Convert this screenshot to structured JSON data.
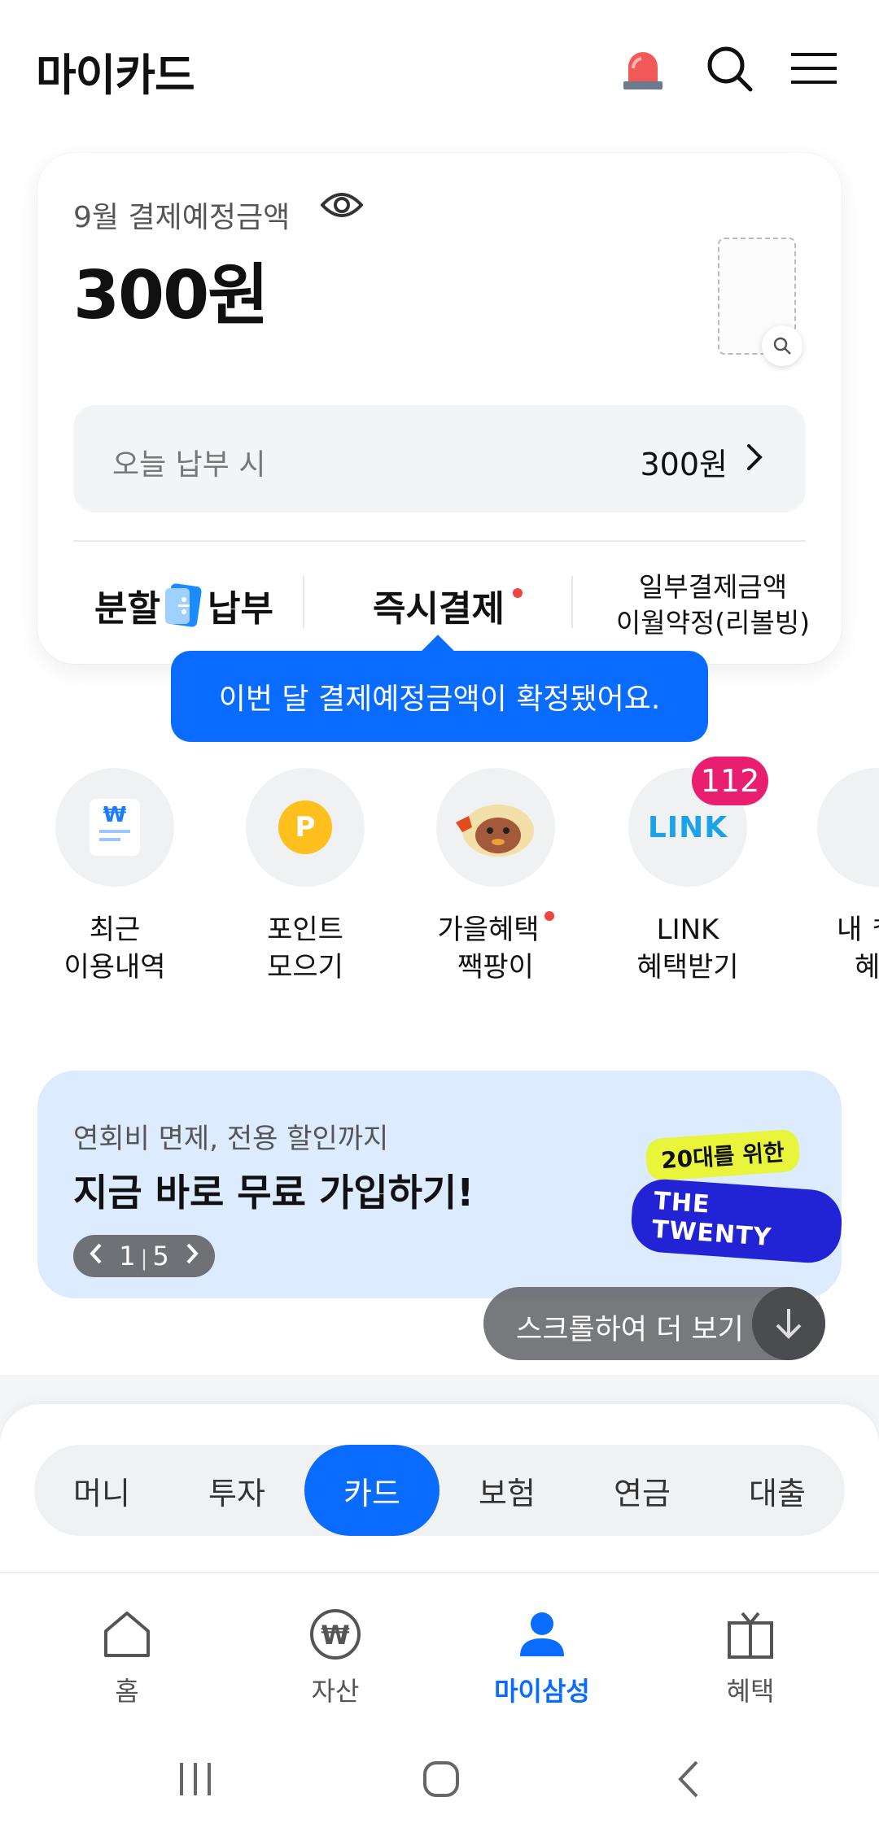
{
  "header": {
    "title": "마이카드"
  },
  "card": {
    "due_label": "9월 결제예정금액",
    "amount": "300원",
    "pay_today_label": "오늘 납부 시",
    "pay_today_amount": "300원",
    "actions": {
      "installment_left": "분할",
      "installment_right": "납부",
      "instant_pay": "즉시결제",
      "partial_line1": "일부결제금액",
      "partial_line2": "이월약정(리볼빙)"
    }
  },
  "tooltip": "이번 달 결제예정금액이 확정됐어요.",
  "quick_menu": [
    {
      "line1": "최근",
      "line2": "이용내역"
    },
    {
      "line1": "포인트",
      "line2": "모으기"
    },
    {
      "line1": "가을혜택",
      "line2": "짹팡이"
    },
    {
      "line1": "LINK",
      "line2": "혜택받기"
    },
    {
      "line1": "내 ᄎ",
      "line2": "혜"
    }
  ],
  "link_badge": "112",
  "link_icon_text": "LINK",
  "point_icon_text": "P",
  "banner": {
    "subtitle": "연회비 면제, 전용 할인까지",
    "title": "지금 바로 무료 가입하기!",
    "pager_current": "1",
    "pager_total": "5",
    "promo_top": "20대를 위한",
    "promo_bottom": "THE TWENTY"
  },
  "scroll_hint": "스크롤하여 더 보기",
  "segments": [
    "머니",
    "투자",
    "카드",
    "보험",
    "연금",
    "대출"
  ],
  "segment_active": "카드",
  "bottom_nav": [
    "홈",
    "자산",
    "마이삼성",
    "혜택"
  ],
  "colors": {
    "accent": "#0a6cff",
    "badge": "#ea1e70",
    "alert": "#f0453f"
  }
}
